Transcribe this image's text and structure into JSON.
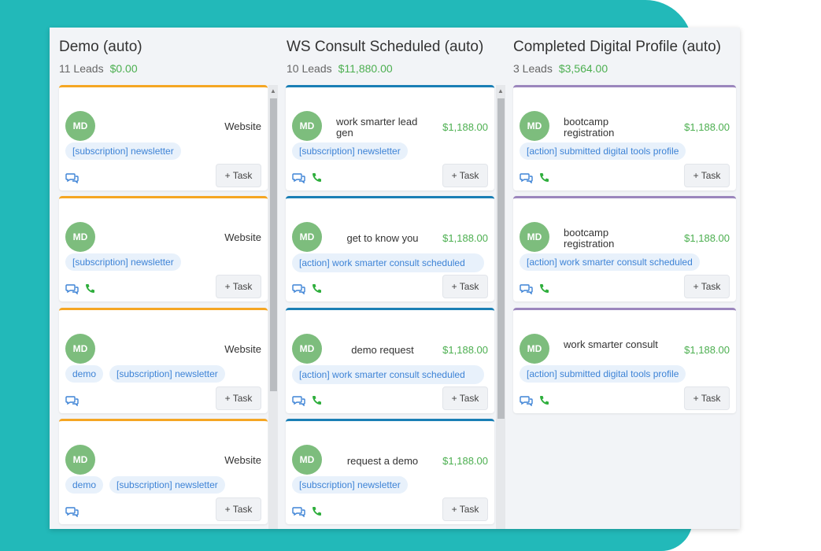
{
  "columns": [
    {
      "title": "Demo (auto)",
      "leads_count": "11 Leads",
      "amount": "$0.00",
      "cards": [
        {
          "initials": "MD",
          "source": "Website",
          "tags": [
            "[subscription] newsletter"
          ],
          "phone": false,
          "task_label": "+ Task"
        },
        {
          "initials": "MD",
          "source": "Website",
          "tags": [
            "[subscription] newsletter"
          ],
          "phone": true,
          "task_label": "+ Task"
        },
        {
          "initials": "MD",
          "source": "Website",
          "tags": [
            "demo",
            "[subscription] newsletter"
          ],
          "phone": false,
          "task_label": "+ Task"
        },
        {
          "initials": "MD",
          "source": "Website",
          "tags": [
            "demo",
            "[subscription] newsletter"
          ],
          "phone": false,
          "task_label": "+ Task"
        }
      ]
    },
    {
      "title": "WS Consult Scheduled (auto)",
      "leads_count": "10 Leads",
      "amount": "$11,880.00",
      "cards": [
        {
          "initials": "MD",
          "name": "work smarter lead gen",
          "value": "$1,188.00",
          "tags": [
            "[subscription] newsletter"
          ],
          "phone": true,
          "task_label": "+ Task"
        },
        {
          "initials": "MD",
          "name": "get to know you",
          "value": "$1,188.00",
          "tags": [
            "[action] work smarter consult scheduled"
          ],
          "phone": true,
          "task_label": "+ Task"
        },
        {
          "initials": "MD",
          "name": "demo request",
          "value": "$1,188.00",
          "tags": [
            "[action] work smarter consult scheduled"
          ],
          "phone": true,
          "task_label": "+ Task"
        },
        {
          "initials": "MD",
          "name": "request a demo",
          "value": "$1,188.00",
          "tags": [
            "[subscription] newsletter"
          ],
          "phone": true,
          "task_label": "+ Task"
        }
      ]
    },
    {
      "title": "Completed Digital Profile (auto)",
      "leads_count": "3 Leads",
      "amount": "$3,564.00",
      "cards": [
        {
          "initials": "MD",
          "name": "bootcamp registration",
          "value": "$1,188.00",
          "tags": [
            "[action] submitted digital tools profile"
          ],
          "phone": true,
          "task_label": "+ Task"
        },
        {
          "initials": "MD",
          "name": "bootcamp registration",
          "value": "$1,188.00",
          "tags": [
            "[action] work smarter consult scheduled"
          ],
          "phone": true,
          "task_label": "+ Task"
        },
        {
          "initials": "MD",
          "name": "work smarter consult",
          "value": "$1,188.00",
          "tags": [
            "[action] submitted digital tools profile"
          ],
          "phone": true,
          "task_label": "+ Task"
        }
      ]
    }
  ],
  "colors": {
    "background_accent": "#22b9b9",
    "amount_green": "#4caf50",
    "tag_text": "#3d83d6",
    "stage_orange": "#f5a623",
    "stage_blue": "#1a7fb5",
    "stage_purple": "#9b86bd"
  },
  "icons": {
    "chat": "chat-bubbles-icon",
    "phone": "phone-icon",
    "scroll_up": "arrow-up-icon"
  }
}
